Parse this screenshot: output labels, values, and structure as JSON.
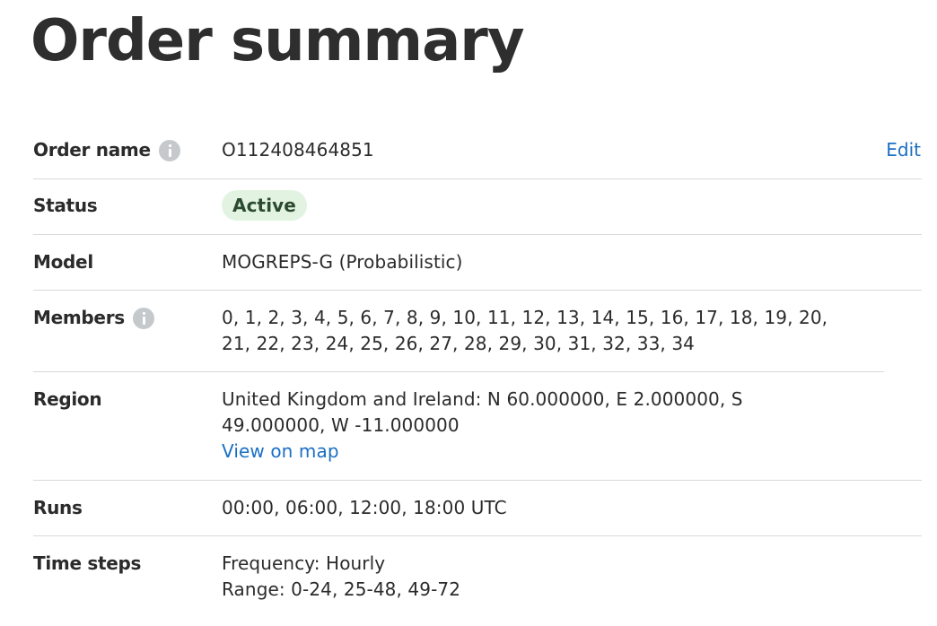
{
  "page": {
    "title": "Order summary"
  },
  "summary": {
    "order_name": {
      "label": "Order name",
      "value": "O112408464851",
      "action": "Edit"
    },
    "status": {
      "label": "Status",
      "value": "Active"
    },
    "model": {
      "label": "Model",
      "value": "MOGREPS-G (Probabilistic)"
    },
    "members": {
      "label": "Members",
      "lines": [
        "0, 1, 2, 3, 4, 5, 6, 7, 8, 9, 10, 11, 12, 13, 14, 15, 16, 17, 18, 19, 20,",
        "21, 22, 23, 24, 25, 26, 27, 28, 29, 30, 31, 32, 33, 34"
      ]
    },
    "region": {
      "label": "Region",
      "lines": [
        "United Kingdom and Ireland: N 60.000000, E 2.000000, S",
        "49.000000, W -11.000000"
      ],
      "link": "View on map"
    },
    "runs": {
      "label": "Runs",
      "value": "00:00, 06:00, 12:00, 18:00 UTC"
    },
    "time_steps": {
      "label": "Time steps",
      "lines": [
        "Frequency: Hourly",
        "Range: 0-24, 25-48, 49-72"
      ]
    }
  },
  "colors": {
    "link": "#1a6fc4",
    "status_badge_bg": "#e2f4e1",
    "status_badge_text": "#2b4a2f",
    "divider": "#d9d9d9",
    "info_icon": "#c5c9cc"
  },
  "icons": {
    "order_name_info": "info-icon",
    "members_info": "info-icon"
  }
}
